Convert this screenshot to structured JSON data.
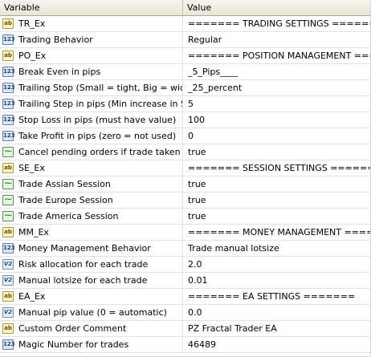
{
  "columns": {
    "variable": "Variable",
    "value": "Value"
  },
  "rows": [
    {
      "icon": "string-type-icon",
      "type": "ab",
      "badge": "ab",
      "name": "TR_Ex",
      "value": "======= TRADING SETTINGS ======="
    },
    {
      "icon": "integer-type-icon",
      "type": "n123",
      "badge": "123",
      "name": "Trading Behavior",
      "value": "Regular"
    },
    {
      "icon": "string-type-icon",
      "type": "ab",
      "badge": "ab",
      "name": "PO_Ex",
      "value": "======= POSITION MANAGEMENT ======="
    },
    {
      "icon": "integer-type-icon",
      "type": "n123",
      "badge": "123",
      "name": "Break Even in pips",
      "value": "_5_Pips____"
    },
    {
      "icon": "integer-type-icon",
      "type": "n123",
      "badge": "123",
      "name": "Trailing Stop (Small = tight, Big = wide)",
      "value": "_25_percent"
    },
    {
      "icon": "integer-type-icon",
      "type": "n123",
      "badge": "123",
      "name": "Trailing Step in pips (Min increase in SL)",
      "value": "5"
    },
    {
      "icon": "integer-type-icon",
      "type": "n123",
      "badge": "123",
      "name": "Stop Loss in pips (must have value)",
      "value": "100"
    },
    {
      "icon": "integer-type-icon",
      "type": "n123",
      "badge": "123",
      "name": "Take Profit in pips (zero = not used)",
      "value": "0"
    },
    {
      "icon": "boolean-type-icon",
      "type": "bool",
      "badge": "⁓",
      "name": "Cancel pending orders if trade taken",
      "value": "true"
    },
    {
      "icon": "string-type-icon",
      "type": "ab",
      "badge": "ab",
      "name": "SE_Ex",
      "value": "======= SESSION SETTINGS ======="
    },
    {
      "icon": "boolean-type-icon",
      "type": "bool",
      "badge": "⁓",
      "name": "Trade Assian Session",
      "value": "true"
    },
    {
      "icon": "boolean-type-icon",
      "type": "bool",
      "badge": "⁓",
      "name": "Trade Europe Session",
      "value": "true"
    },
    {
      "icon": "boolean-type-icon",
      "type": "bool",
      "badge": "⁓",
      "name": "Trade America Session",
      "value": "true"
    },
    {
      "icon": "string-type-icon",
      "type": "ab",
      "badge": "ab",
      "name": "MM_Ex",
      "value": "======= MONEY MANAGEMENT ======="
    },
    {
      "icon": "integer-type-icon",
      "type": "n123",
      "badge": "123",
      "name": "Money Management Behavior",
      "value": "Trade manual lotsize"
    },
    {
      "icon": "double-type-icon",
      "type": "v2",
      "badge": "V2",
      "name": "Risk allocation for each trade",
      "value": "2.0"
    },
    {
      "icon": "double-type-icon",
      "type": "v2",
      "badge": "V2",
      "name": "Manual lotsize for each trade",
      "value": "0.01"
    },
    {
      "icon": "string-type-icon",
      "type": "ab",
      "badge": "ab",
      "name": "EA_Ex",
      "value": "======= EA SETTINGS ======="
    },
    {
      "icon": "double-type-icon",
      "type": "v2",
      "badge": "V2",
      "name": "Manual pip value (0 = automatic)",
      "value": "0.0"
    },
    {
      "icon": "string-type-icon",
      "type": "ab",
      "badge": "ab",
      "name": "Custom Order Comment",
      "value": "PZ Fractal Trader EA"
    },
    {
      "icon": "integer-type-icon",
      "type": "n123",
      "badge": "123",
      "name": "Magic Number for trades",
      "value": "46489"
    }
  ]
}
